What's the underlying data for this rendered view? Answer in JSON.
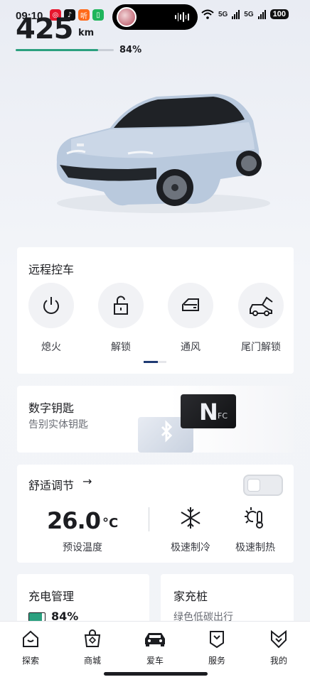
{
  "status_bar": {
    "time": "09:10",
    "apps": [
      {
        "icon": "weibo-icon",
        "color": "#e6162d",
        "glyph": "◎"
      },
      {
        "icon": "tiktok-icon",
        "color": "#111111",
        "glyph": "♪"
      },
      {
        "icon": "ting-icon",
        "color": "#ff6a1a",
        "glyph": "听"
      },
      {
        "icon": "battery-app-icon",
        "color": "#1fb55c",
        "glyph": "▯"
      }
    ],
    "signal1": "5G",
    "signal2": "5G",
    "battery": "100"
  },
  "vehicle": {
    "range_value": "425",
    "range_unit": "km",
    "battery_percent_label": "84%",
    "battery_fraction": 0.84
  },
  "remote_control": {
    "title": "远程控车",
    "items": [
      {
        "label": "熄火",
        "icon": "power-icon"
      },
      {
        "label": "解锁",
        "icon": "unlock-icon"
      },
      {
        "label": "通风",
        "icon": "window-vent-icon"
      },
      {
        "label": "尾门解锁",
        "icon": "tailgate-icon"
      }
    ],
    "page_index": 0,
    "page_count": 2
  },
  "digital_key": {
    "title": "数字钥匙",
    "subtitle": "告别实体钥匙",
    "nfc_n": "N",
    "nfc_fc": "FC"
  },
  "comfort": {
    "title": "舒适调节",
    "arrow": "→",
    "toggle_on": false,
    "temp_value": "26.0",
    "temp_unit": "°C",
    "temp_label": "预设温度",
    "cool_label": "极速制冷",
    "heat_label": "极速制热"
  },
  "charging": {
    "title": "充电管理",
    "percent_label": "84%",
    "fraction": 0.84
  },
  "home_charger": {
    "title": "家充桩",
    "subtitle": "绿色低碳出行"
  },
  "nav": {
    "items": [
      {
        "label": "探索",
        "icon": "explore-home-icon"
      },
      {
        "label": "商城",
        "icon": "shop-bag-icon"
      },
      {
        "label": "爱车",
        "icon": "car-icon"
      },
      {
        "label": "服务",
        "icon": "service-icon"
      },
      {
        "label": "我的",
        "icon": "profile-icon"
      }
    ],
    "active": "爱车"
  }
}
